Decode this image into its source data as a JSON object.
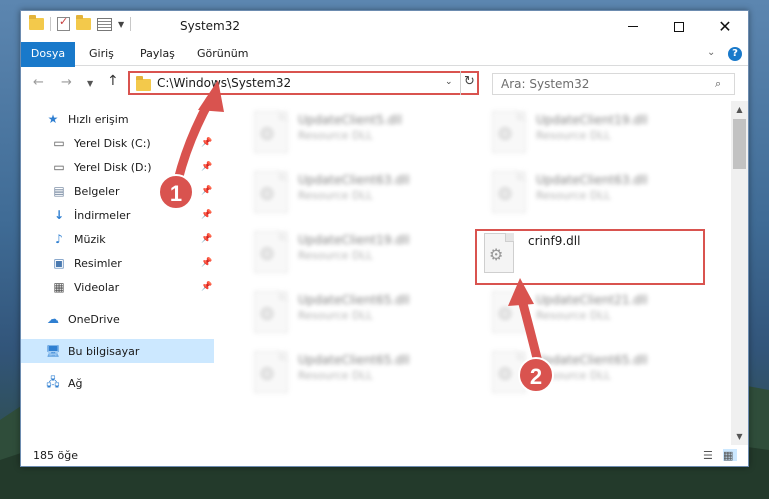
{
  "window": {
    "title": "System32"
  },
  "ribbon": {
    "tabs": [
      "Dosya",
      "Giriş",
      "Paylaş",
      "Görünüm"
    ]
  },
  "address": {
    "path": "C:\\Windows\\System32"
  },
  "search": {
    "placeholder": "Ara: System32"
  },
  "sidebar": {
    "items": [
      {
        "label": "Hızlı erişim",
        "icon": "star-icon"
      },
      {
        "label": "Yerel Disk (C:)",
        "icon": "drive-icon",
        "pinned": true
      },
      {
        "label": "Yerel Disk (D:)",
        "icon": "drive-icon",
        "pinned": true
      },
      {
        "label": "Belgeler",
        "icon": "document-icon",
        "pinned": true
      },
      {
        "label": "İndirmeler",
        "icon": "download-icon",
        "pinned": true
      },
      {
        "label": "Müzik",
        "icon": "music-icon",
        "pinned": true
      },
      {
        "label": "Resimler",
        "icon": "pictures-icon",
        "pinned": true
      },
      {
        "label": "Videolar",
        "icon": "video-icon",
        "pinned": true
      },
      {
        "label": "OneDrive",
        "icon": "cloud-icon"
      },
      {
        "label": "Bu bilgisayar",
        "icon": "computer-icon",
        "selected": true
      },
      {
        "label": "Ağ",
        "icon": "network-icon"
      }
    ]
  },
  "files": [
    {
      "name": "UpdateClient5.dll",
      "type": "Resource DLL"
    },
    {
      "name": "UpdateClient19.dll",
      "type": "Resource DLL"
    },
    {
      "name": "UpdateClient63.dll",
      "type": "Resource DLL"
    },
    {
      "name": "UpdateClient63.dll",
      "type": "Resource DLL"
    },
    {
      "name": "UpdateClient19.dll",
      "type": "Resource DLL"
    },
    {
      "name": "crinf9.dll",
      "type": "",
      "highlighted": true
    },
    {
      "name": "UpdateClient65.dll",
      "type": "Resource DLL"
    },
    {
      "name": "UpdateClient21.dll",
      "type": "Resource DLL"
    },
    {
      "name": "UpdateClient65.dll",
      "type": "Resource DLL"
    },
    {
      "name": "UpdateClient65.dll",
      "type": "Resource DLL"
    }
  ],
  "status": {
    "count": "185 öğe"
  },
  "annotations": {
    "step1": "1",
    "step2": "2",
    "color": "#d9534f"
  }
}
